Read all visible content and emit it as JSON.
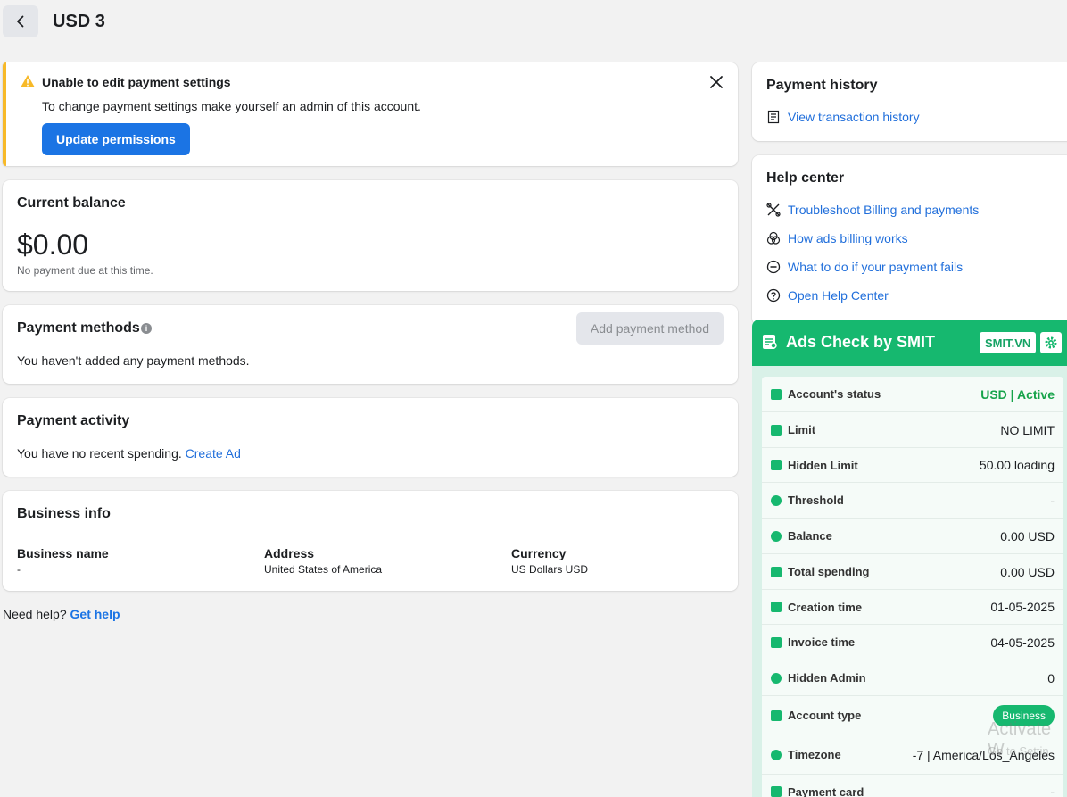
{
  "header": {
    "title": "USD 3"
  },
  "alert": {
    "title": "Unable to edit payment settings",
    "text": "To change payment settings make yourself an admin of this account.",
    "button": "Update permissions"
  },
  "balance": {
    "title": "Current balance",
    "amount": "$0.00",
    "note": "No payment due at this time."
  },
  "payment_methods": {
    "title": "Payment methods",
    "button": "Add payment method",
    "text": "You haven't added any payment methods."
  },
  "payment_activity": {
    "title": "Payment activity",
    "text": "You have no recent spending.",
    "link": "Create Ad"
  },
  "business_info": {
    "title": "Business info",
    "columns": [
      {
        "header": "Business name",
        "value": "-"
      },
      {
        "header": "Address",
        "value": "United States of America"
      },
      {
        "header": "Currency",
        "value": "US Dollars USD"
      }
    ]
  },
  "need_help": {
    "text": "Need help?",
    "link": "Get help"
  },
  "payment_history": {
    "title": "Payment history",
    "link": "View transaction history"
  },
  "help_center": {
    "title": "Help center",
    "links": [
      {
        "label": "Troubleshoot Billing and payments",
        "icon": "tools-icon"
      },
      {
        "label": "How ads billing works",
        "icon": "circles-icon"
      },
      {
        "label": "What to do if your payment fails",
        "icon": "minus-circle-icon"
      },
      {
        "label": "Open Help Center",
        "icon": "question-circle-icon"
      }
    ]
  },
  "ads_check": {
    "title": "Ads Check by SMIT",
    "badge": "SMIT.VN",
    "rows": [
      {
        "label": "Account's status",
        "value": "USD | Active"
      },
      {
        "label": "Limit",
        "value": "NO LIMIT"
      },
      {
        "label": "Hidden Limit",
        "value": "50.00 loading"
      },
      {
        "label": "Threshold",
        "value": "-"
      },
      {
        "label": "Balance",
        "value": "0.00 USD"
      },
      {
        "label": "Total spending",
        "value": "0.00 USD"
      },
      {
        "label": "Creation time",
        "value": "01-05-2025"
      },
      {
        "label": "Invoice time",
        "value": "04-05-2025"
      },
      {
        "label": "Hidden Admin",
        "value": "0"
      },
      {
        "label": "Account type",
        "value": "Business"
      },
      {
        "label": "Timezone",
        "value": "-7 | America/Los_Angeles"
      },
      {
        "label": "Payment card",
        "value": "-"
      }
    ]
  },
  "watermark": {
    "line1": "Activate W",
    "line2": "Go to Settin"
  },
  "colors": {
    "primary": "#1b74e4",
    "accent_green": "#16b86f",
    "warning": "#f7b928"
  }
}
